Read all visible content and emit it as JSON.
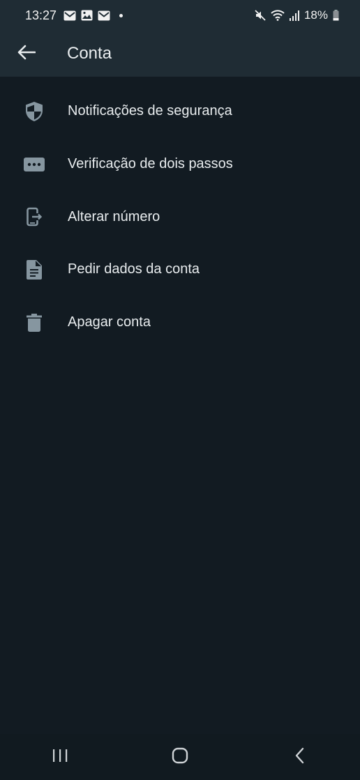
{
  "status_bar": {
    "time": "13:27",
    "battery": "18%",
    "icons_left": [
      "gmail-icon",
      "gallery-icon",
      "gmail-icon"
    ],
    "icons_right": [
      "mute-icon",
      "wifi-icon",
      "signal-icon",
      "battery-icon"
    ]
  },
  "app_bar": {
    "title": "Conta",
    "back_icon": "arrow-left-icon"
  },
  "menu": {
    "items": [
      {
        "label": "Notificações de segurança",
        "icon": "shield-icon"
      },
      {
        "label": "Verificação de dois passos",
        "icon": "password-dots-icon"
      },
      {
        "label": "Alterar número",
        "icon": "change-number-icon"
      },
      {
        "label": "Pedir dados da conta",
        "icon": "document-icon"
      },
      {
        "label": "Apagar conta",
        "icon": "trash-icon"
      }
    ]
  },
  "nav_bar": {
    "buttons": [
      "recents-icon",
      "home-icon",
      "back-icon"
    ]
  },
  "colors": {
    "background": "#121b22",
    "app_bar": "#1f2c34",
    "text": "#e9edef",
    "icon": "#8696a0"
  }
}
